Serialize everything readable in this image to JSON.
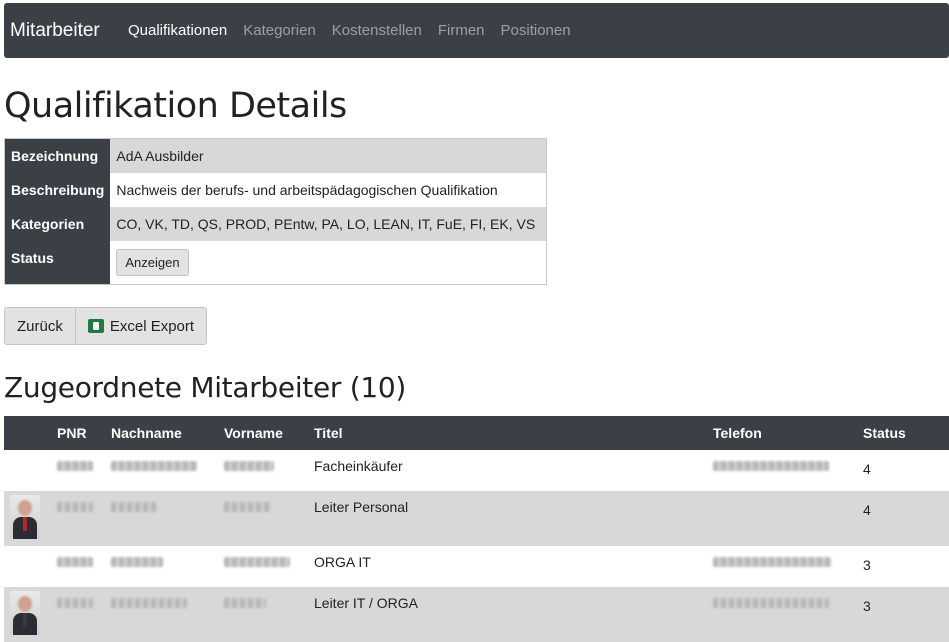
{
  "navbar": {
    "brand": "Mitarbeiter",
    "items": [
      {
        "label": "Qualifikationen",
        "active": true
      },
      {
        "label": "Kategorien",
        "active": false
      },
      {
        "label": "Kostenstellen",
        "active": false
      },
      {
        "label": "Firmen",
        "active": false
      },
      {
        "label": "Positionen",
        "active": false
      }
    ]
  },
  "details": {
    "title": "Qualifikation Details",
    "rows": [
      {
        "label": "Bezeichnung",
        "value": "AdA Ausbilder"
      },
      {
        "label": "Beschreibung",
        "value": "Nachweis der berufs- und arbeitspädagogischen Qualifikation"
      },
      {
        "label": "Kategorien",
        "value": "CO, VK, TD, QS, PROD, PEntw, PA, LO, LEAN, IT, FuE, FI, EK, VS"
      }
    ],
    "status_label": "Status",
    "status_button": "Anzeigen"
  },
  "actions": {
    "back_label": "Zurück",
    "export_label": "Excel Export",
    "export_icon": "excel-icon"
  },
  "employees": {
    "title": "Zugeordnete Mitarbeiter (10)",
    "columns": [
      "",
      "PNR",
      "Nachname",
      "Vorname",
      "Titel",
      "Telefon",
      "Status"
    ],
    "rows": [
      {
        "has_photo": false,
        "titel": "Facheinkäufer",
        "status": "4"
      },
      {
        "has_photo": true,
        "titel": "Leiter Personal",
        "status": "4"
      },
      {
        "has_photo": false,
        "titel": "ORGA IT",
        "status": "3"
      },
      {
        "has_photo": true,
        "titel": "Leiter IT / ORGA",
        "status": "3"
      }
    ]
  },
  "colors": {
    "navbar_bg": "#3b4046",
    "row_stripe": "#d8d8d8",
    "excel_green": "#1f7a3e"
  }
}
